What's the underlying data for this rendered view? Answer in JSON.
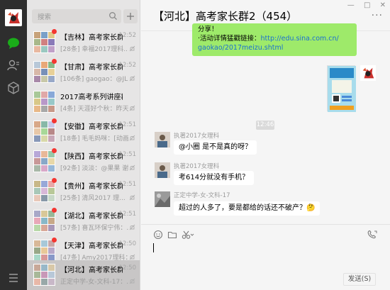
{
  "search": {
    "placeholder": "搜索"
  },
  "chats": [
    {
      "name": "【吉林】高考家长群",
      "time": "12:52",
      "preview": "[28条] 幸福2017理科..."
    },
    {
      "name": "【甘肃】高考家长群",
      "time": "12:52",
      "preview": "[106条] gaogao：@JL2..."
    },
    {
      "name": "2017高考系列讲座群1",
      "time": "",
      "preview": "[4条] 天涯好个秋：昨天..."
    },
    {
      "name": "【安徽】高考家长群1",
      "time": "12:51",
      "preview": "[18条] 毛毛妈咪：[动画..."
    },
    {
      "name": "【陕西】高考家长群1",
      "time": "12:51",
      "preview": "[92条] 淡淡：@果果 谢谢"
    },
    {
      "name": "【贵州】高考家长群",
      "time": "12:51",
      "preview": "[25条] 清风2017 理..."
    },
    {
      "name": "【湖北】高考家长群1",
      "time": "12:51",
      "preview": "[57条] 喜瓦环保宁伟：..."
    },
    {
      "name": "【天津】高考家长群",
      "time": "12:50",
      "preview": "[47条] Amy2017理科：..."
    },
    {
      "name": "【河北】高考家长群2",
      "time": "12:50",
      "preview": "正定中学-女-文科-17：..."
    }
  ],
  "chat": {
    "title": "【河北】高考家长群2（454）",
    "more": "···",
    "window_controls": [
      "—",
      "□",
      "✕"
    ],
    "green_line1": "分享！",
    "green_line2": "·活动详情猛戳链接：",
    "green_link1": "http://edu.sina.com.cn/",
    "green_link2": "gaokao/2017meizu.shtml",
    "time_chip": "12:46",
    "messages": [
      {
        "sender": "执著2017女理科",
        "text": "@小圈 是不是真的呀？"
      },
      {
        "sender": "执著2017女理科",
        "text": "考614分就没有手机？"
      },
      {
        "sender": "正定中学-女-文科-17",
        "text": "超过的人多了，要是都给的话还不破产？🤔"
      }
    ],
    "send_label": "发送(S)"
  },
  "icons": [
    "avatar",
    "chat-icon",
    "contacts-icon",
    "favorites-icon",
    "menu-icon",
    "search-icon",
    "add-icon",
    "emoji-icon",
    "folder-icon",
    "scissors-icon",
    "video-call-icon",
    "mute-icon"
  ],
  "colors": {
    "nav_bg": "#2e2e2e",
    "list_bg": "#e6e5e5",
    "selected_bg": "#c8c6c6",
    "main_bg": "#f5f5f5",
    "green_bubble": "#9eea6a",
    "unread_dot": "#f43530",
    "link": "#1b6fd1"
  }
}
